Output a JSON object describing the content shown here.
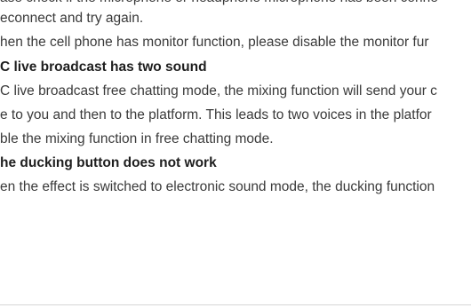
{
  "lines": [
    {
      "text": "ase check if the microphone or headphone microphone has been conne",
      "heading": false
    },
    {
      "text": "econnect and try again.",
      "heading": false
    },
    {
      "text": "hen the cell phone has monitor function, please disable the monitor fur",
      "heading": false
    },
    {
      "text": "C live broadcast has two sound",
      "heading": true
    },
    {
      "text": "C live broadcast free chatting mode, the mixing function will send your c",
      "heading": false
    },
    {
      "text": "e to you and then to the platform. This leads to two voices in the platfor",
      "heading": false
    },
    {
      "text": "ble the mixing function in free chatting mode.",
      "heading": false
    },
    {
      "text": "he ducking button does not work",
      "heading": true
    },
    {
      "text": "en the effect is switched to electronic sound mode, the ducking function",
      "heading": false
    }
  ]
}
